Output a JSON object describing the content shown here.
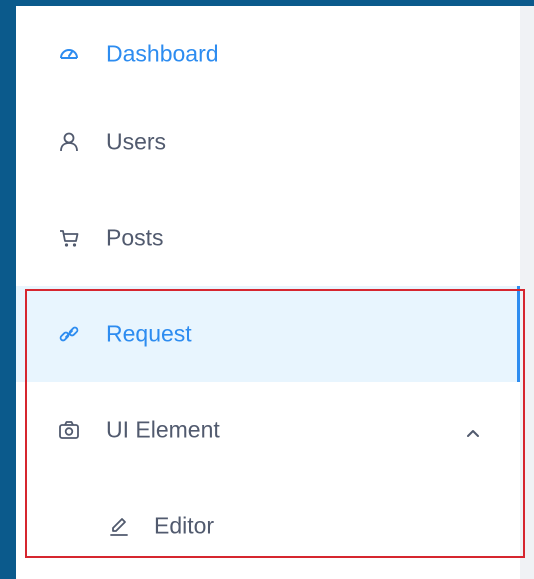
{
  "menu": {
    "items": [
      {
        "label": "Dashboard",
        "icon": "dashboard-gauge-icon",
        "state": "selected"
      },
      {
        "label": "Users",
        "icon": "user-icon"
      },
      {
        "label": "Posts",
        "icon": "cart-icon"
      },
      {
        "label": "Request",
        "icon": "link-icon",
        "state": "active"
      },
      {
        "label": "UI Element",
        "icon": "camera-icon",
        "expanded": true
      },
      {
        "label": "Editor",
        "icon": "pen-icon",
        "parent": "UI Element"
      }
    ]
  },
  "colors": {
    "frame": "#0b5a8c",
    "accent": "#2d8cf0",
    "active_bg": "#e8f5fe",
    "text": "#515a6e",
    "highlight_border": "#d6262f"
  }
}
